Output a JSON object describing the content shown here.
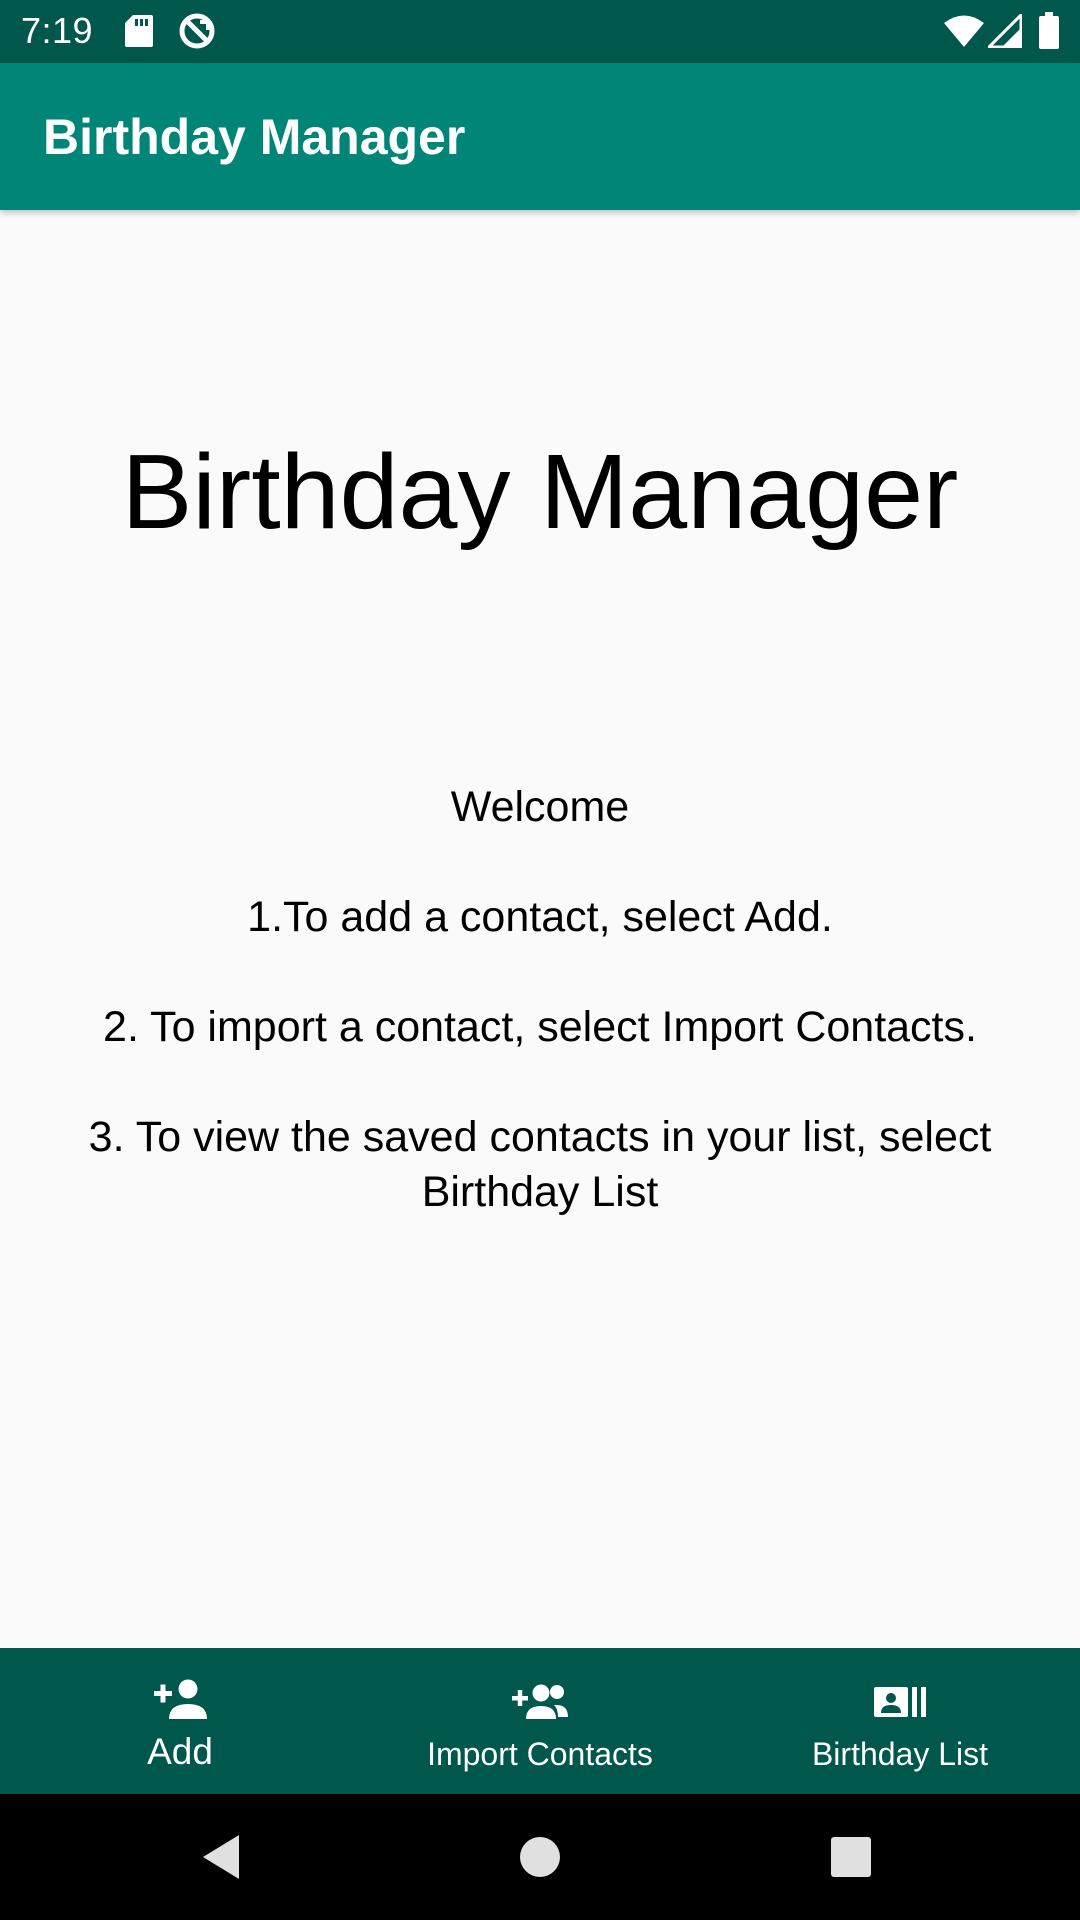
{
  "status_bar": {
    "time": "7:19",
    "icons": [
      "sd-card-icon",
      "no-disturb-icon",
      "wifi-icon",
      "signal-icon",
      "battery-icon"
    ]
  },
  "app_bar": {
    "title": "Birthday Manager"
  },
  "main": {
    "hero_title": "Birthday Manager",
    "welcome": "Welcome",
    "instruction_1": "1.To add a contact, select Add.",
    "instruction_2": "2. To import a contact, select Import Contacts.",
    "instruction_3a": "3. To view the saved contacts in your list, select",
    "instruction_3b": "Birthday List"
  },
  "bottom_nav": {
    "items": [
      {
        "label": "Add",
        "icon": "add-person-icon",
        "active": true
      },
      {
        "label": "Import Contacts",
        "icon": "add-group-icon",
        "active": false
      },
      {
        "label": "Birthday List",
        "icon": "contact-list-icon",
        "active": false
      }
    ]
  },
  "system_nav": {
    "buttons": [
      "back-icon",
      "home-icon",
      "recents-icon"
    ]
  },
  "colors": {
    "status_bar": "#00574b",
    "app_bar": "#008577",
    "bottom_nav": "#00574b",
    "background": "#fafafa",
    "system_nav": "#000000"
  }
}
